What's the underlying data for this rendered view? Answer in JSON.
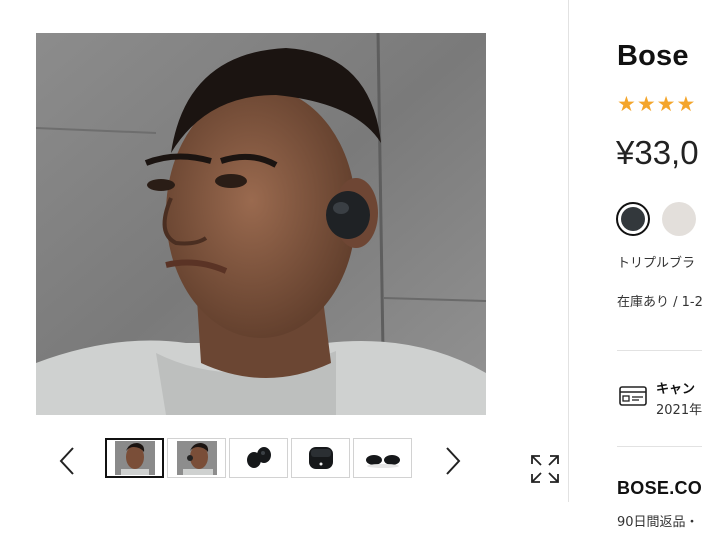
{
  "product": {
    "title": "Bose",
    "rating_stars": 4,
    "price": "¥33,0",
    "selected_color": "トリプルブラ",
    "stock": "在庫あり / 1-2"
  },
  "colors": {
    "swatch_1": "#33383c",
    "swatch_2": "#e3dfdb",
    "star": "#f4a52b"
  },
  "gallery": {
    "thumbnails": [
      "model-face-right",
      "model-face-left",
      "earbuds-pair",
      "charging-case",
      "earbuds-side"
    ],
    "active_index": 0
  },
  "campaign": {
    "title": "キャン",
    "date": "2021年"
  },
  "store": {
    "title": "BOSE.CO",
    "return_policy": "90日間返品・"
  }
}
